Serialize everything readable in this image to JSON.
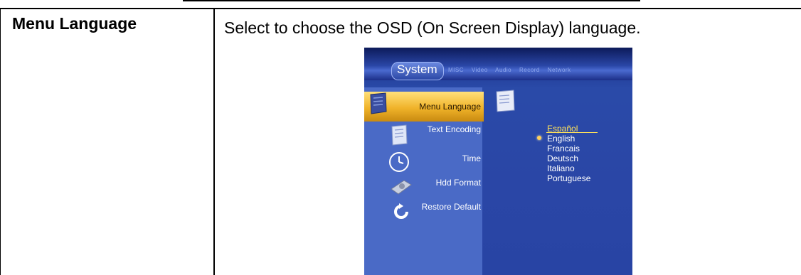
{
  "row": {
    "term": "Menu Language",
    "description": "Select to choose the OSD (On Screen Display) language."
  },
  "osd": {
    "tab_label": "System",
    "subtabs": [
      "MISC",
      "Video",
      "Audio",
      "Record",
      "Network"
    ],
    "menu_items": [
      {
        "label": "Menu Language",
        "icon": "flag-icon",
        "active": true
      },
      {
        "label": "Text Encoding",
        "icon": "document-icon",
        "active": false
      },
      {
        "label": "Time",
        "icon": "clock-icon",
        "active": false
      },
      {
        "label": "Hdd Format",
        "icon": "hard-disk-icon",
        "active": false
      },
      {
        "label": "Restore Default",
        "icon": "restore-arrow-icon",
        "active": false
      }
    ],
    "languages": [
      "Español",
      "English",
      "Francais",
      "Deutsch",
      "Italiano",
      "Portuguese"
    ],
    "selected_language": "English",
    "highlighted_language": "Español",
    "colors": {
      "osd_background": "#2a46a6",
      "sidebar": "#4a6ac6",
      "highlight": "#f0b32a",
      "selected_text": "#ffe25a"
    }
  }
}
